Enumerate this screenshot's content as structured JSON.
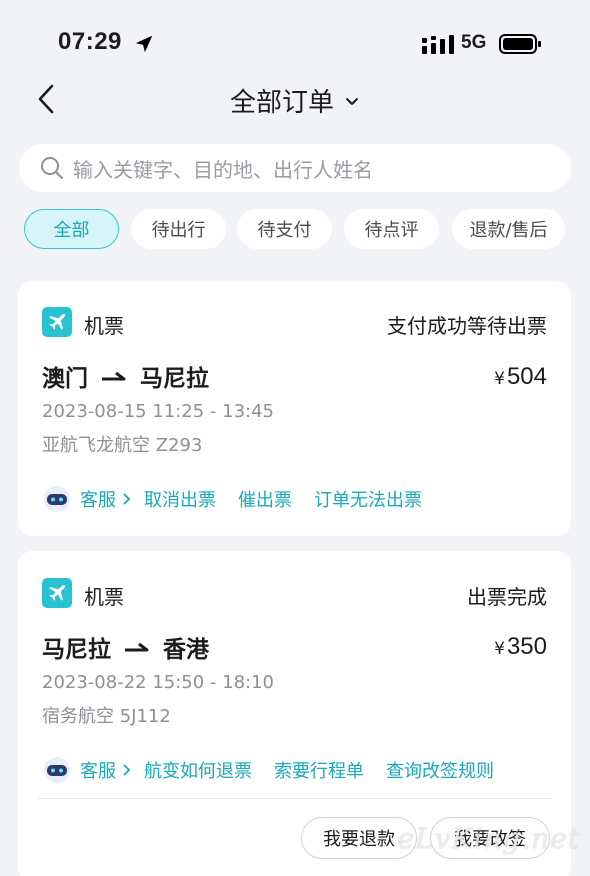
{
  "status_bar": {
    "time": "07:29",
    "network": "5G"
  },
  "header": {
    "title": "全部订单"
  },
  "search": {
    "placeholder": "输入关键字、目的地、出行人姓名"
  },
  "tabs": [
    {
      "label": "全部",
      "active": true
    },
    {
      "label": "待出行",
      "active": false
    },
    {
      "label": "待支付",
      "active": false
    },
    {
      "label": "待点评",
      "active": false
    },
    {
      "label": "退款/售后",
      "active": false
    }
  ],
  "orders": [
    {
      "type_label": "机票",
      "status": "支付成功等待出票",
      "origin": "澳门",
      "destination": "马尼拉",
      "currency": "¥",
      "price": "504",
      "time": "2023-08-15 11:25 - 13:45",
      "flight": "亚航飞龙航空 Z293",
      "service_label": "客服",
      "actions": [
        "取消出票",
        "催出票",
        "订单无法出票"
      ]
    },
    {
      "type_label": "机票",
      "status": "出票完成",
      "origin": "马尼拉",
      "destination": "香港",
      "currency": "¥",
      "price": "350",
      "time": "2023-08-22 15:50 - 18:10",
      "flight": "宿务航空 5J112",
      "service_label": "客服",
      "actions": [
        "航变如何退票",
        "索要行程单",
        "查询改签规则"
      ],
      "buttons": [
        "我要退款",
        "我要改签"
      ]
    }
  ],
  "watermark": "eLvKing.net",
  "colors": {
    "accent": "#1aa9b9",
    "icon_bg": "#27c3d4",
    "page_bg": "#f2f3f7"
  }
}
